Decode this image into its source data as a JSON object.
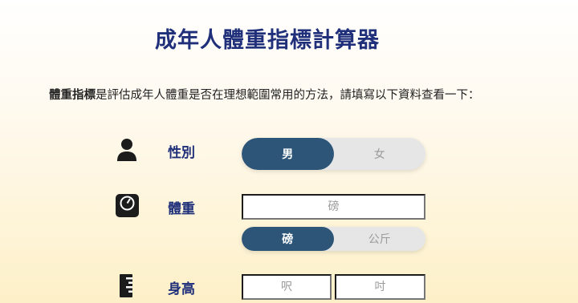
{
  "header": {
    "title": "成年人體重指標計算器"
  },
  "intro": {
    "bold": "體重指標",
    "text": "是評估成年人體重是否在理想範圍常用的方法，請填寫以下資料查看一下："
  },
  "gender": {
    "label": "性別",
    "icon": "person-icon",
    "options": [
      "男",
      "女"
    ],
    "selected": "男"
  },
  "weight": {
    "label": "體重",
    "icon": "scale-icon",
    "placeholder": "磅",
    "units": [
      "磅",
      "公斤"
    ],
    "selected_unit": "磅"
  },
  "height": {
    "label": "身高",
    "icon": "ruler-icon",
    "feet_placeholder": "呎",
    "inch_placeholder": "吋"
  },
  "colors": {
    "accent": "#2d5577",
    "title": "#1f2f7a"
  }
}
